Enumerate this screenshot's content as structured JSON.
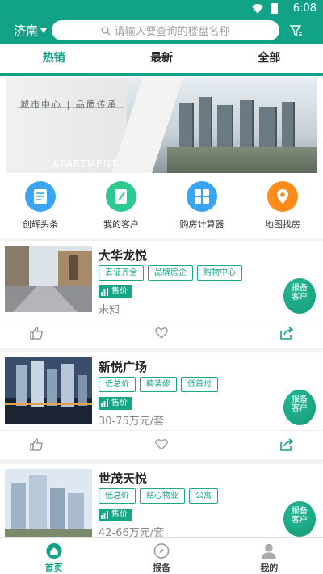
{
  "status_bar": {
    "time": "6:08"
  },
  "header": {
    "city": "济南",
    "search_placeholder": "请输入要查询的楼盘名称"
  },
  "tabs": [
    {
      "label": "热销",
      "active": true
    },
    {
      "label": "最新",
      "active": false
    },
    {
      "label": "全部",
      "active": false
    }
  ],
  "banner": {
    "title": "城市中心 | 品质传承",
    "subtitle": "APARTMENT"
  },
  "quick_links": [
    {
      "label": "创辉头条",
      "icon": "news-icon",
      "color": "#3aa6f3"
    },
    {
      "label": "我的客户",
      "icon": "client-icon",
      "color": "#2fc98f"
    },
    {
      "label": "购房计算器",
      "icon": "calculator-icon",
      "color": "#3aa6f3"
    },
    {
      "label": "地图找房",
      "icon": "map-pin-icon",
      "color": "#ff8c1a"
    }
  ],
  "listings": [
    {
      "name": "大华龙悦",
      "tags": [
        "五证齐全",
        "品牌房企",
        "购物中心"
      ],
      "price_label": "售价",
      "price": "未知",
      "badge": "报备客户"
    },
    {
      "name": "新悦广场",
      "tags": [
        "低总价",
        "精装修",
        "低首付"
      ],
      "price_label": "售价",
      "price": "30-75万元/套",
      "badge": "报备客户"
    },
    {
      "name": "世茂天悦",
      "tags": [
        "低总价",
        "贴心物业",
        "公寓"
      ],
      "price_label": "售价",
      "price": "42-66万元/套",
      "badge": "报备客户"
    }
  ],
  "bottom_nav": [
    {
      "label": "首页",
      "active": true
    },
    {
      "label": "报备",
      "active": false
    },
    {
      "label": "我的",
      "active": false
    }
  ],
  "colors": {
    "brand": "#12a386",
    "tag_border": "#1aa887"
  }
}
